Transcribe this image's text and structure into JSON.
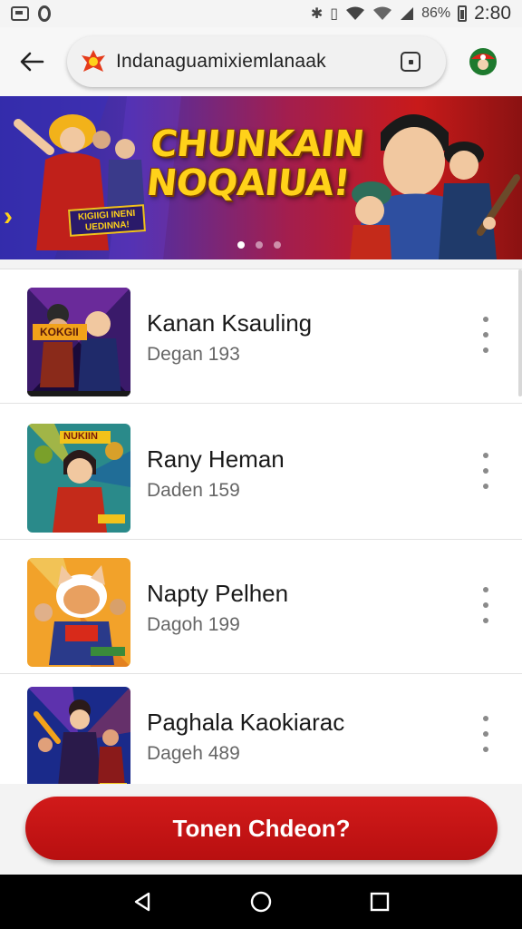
{
  "status_bar": {
    "battery": "86%",
    "time": "2:80"
  },
  "browser": {
    "url": "Indanaguamixiemlanaak"
  },
  "banner": {
    "title_line1": "CHUNKAIN",
    "title_line2": "NOQAIUA!",
    "small_sign": "KIGIIGI INENI UEDINNA!",
    "slides_total": 3,
    "active_slide": 1
  },
  "list": {
    "items": [
      {
        "title": "Kanan Ksauling",
        "subtitle": "Degan 193",
        "thumb_label": "KOKGII"
      },
      {
        "title": "Rany Heman",
        "subtitle": "Daden 159",
        "thumb_label": "NUKIIN"
      },
      {
        "title": "Napty Pelhen",
        "subtitle": "Dagoh 199",
        "thumb_label": ""
      },
      {
        "title": "Paghala Kaokiarac",
        "subtitle": "Dageh 489",
        "thumb_label": ""
      }
    ]
  },
  "cta": {
    "label": "Tonen Chdeon?"
  },
  "colors": {
    "accent": "#c41414",
    "banner_title": "#ffd21a"
  },
  "icons": {
    "back": "arrow-left-icon",
    "site": "site-logo-icon",
    "tabs": "tab-switcher-icon",
    "profile": "profile-icon",
    "more": "kebab-menu-icon",
    "nav_back": "triangle-back-icon",
    "nav_home": "circle-home-icon",
    "nav_recents": "square-recents-icon"
  }
}
